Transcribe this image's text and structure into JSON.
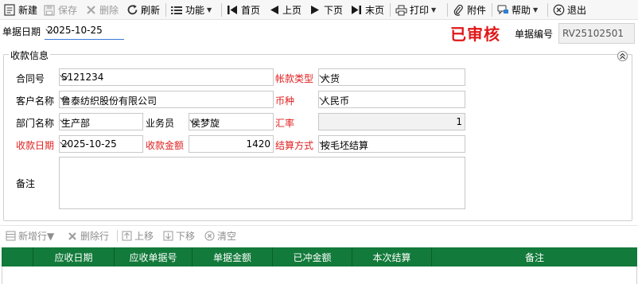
{
  "toolbar": {
    "new": "新建",
    "save": "保存",
    "delete": "删除",
    "refresh": "刷新",
    "functions": "功能",
    "first": "首页",
    "prev": "上页",
    "next": "下页",
    "last": "末页",
    "print": "打印",
    "attachment": "附件",
    "help": "帮助",
    "exit": "退出"
  },
  "header": {
    "date_label": "单据日期",
    "date_value": "2025-10-25",
    "status_stamp": "已审核",
    "doc_no_label": "单据编号",
    "doc_no_value": "RV25102501"
  },
  "group": {
    "title": "收款信息",
    "contract_label": "合同号",
    "contract_value": "S121234",
    "account_type_label": "帐款类型",
    "account_type_value": "大货",
    "customer_label": "客户名称",
    "customer_value": "鲁泰纺织股份有限公司",
    "currency_label": "币种",
    "currency_value": "人民币",
    "dept_label": "部门名称",
    "dept_value": "生产部",
    "salesman_label": "业务员",
    "salesman_value": "侯梦旋",
    "rate_label": "汇率",
    "rate_value": "1",
    "receipt_date_label": "收款日期",
    "receipt_date_value": "2025-10-25",
    "amount_label": "收款金额",
    "amount_value": "1420",
    "settle_label": "结算方式",
    "settle_value": "按毛坯结算",
    "remark_label": "备注",
    "remark_value": ""
  },
  "grid_toolbar": {
    "add_row": "新增行",
    "delete_row": "删除行",
    "move_up": "上移",
    "move_down": "下移",
    "clear": "清空"
  },
  "grid": {
    "columns": [
      "应收日期",
      "应收单据号",
      "单据金额",
      "已冲金额",
      "本次结算",
      "备注"
    ]
  },
  "colors": {
    "grid_header": "#127a3a",
    "required_label": "#e02020",
    "stamp": "#e01818",
    "focus_underline": "#3c78d8"
  }
}
